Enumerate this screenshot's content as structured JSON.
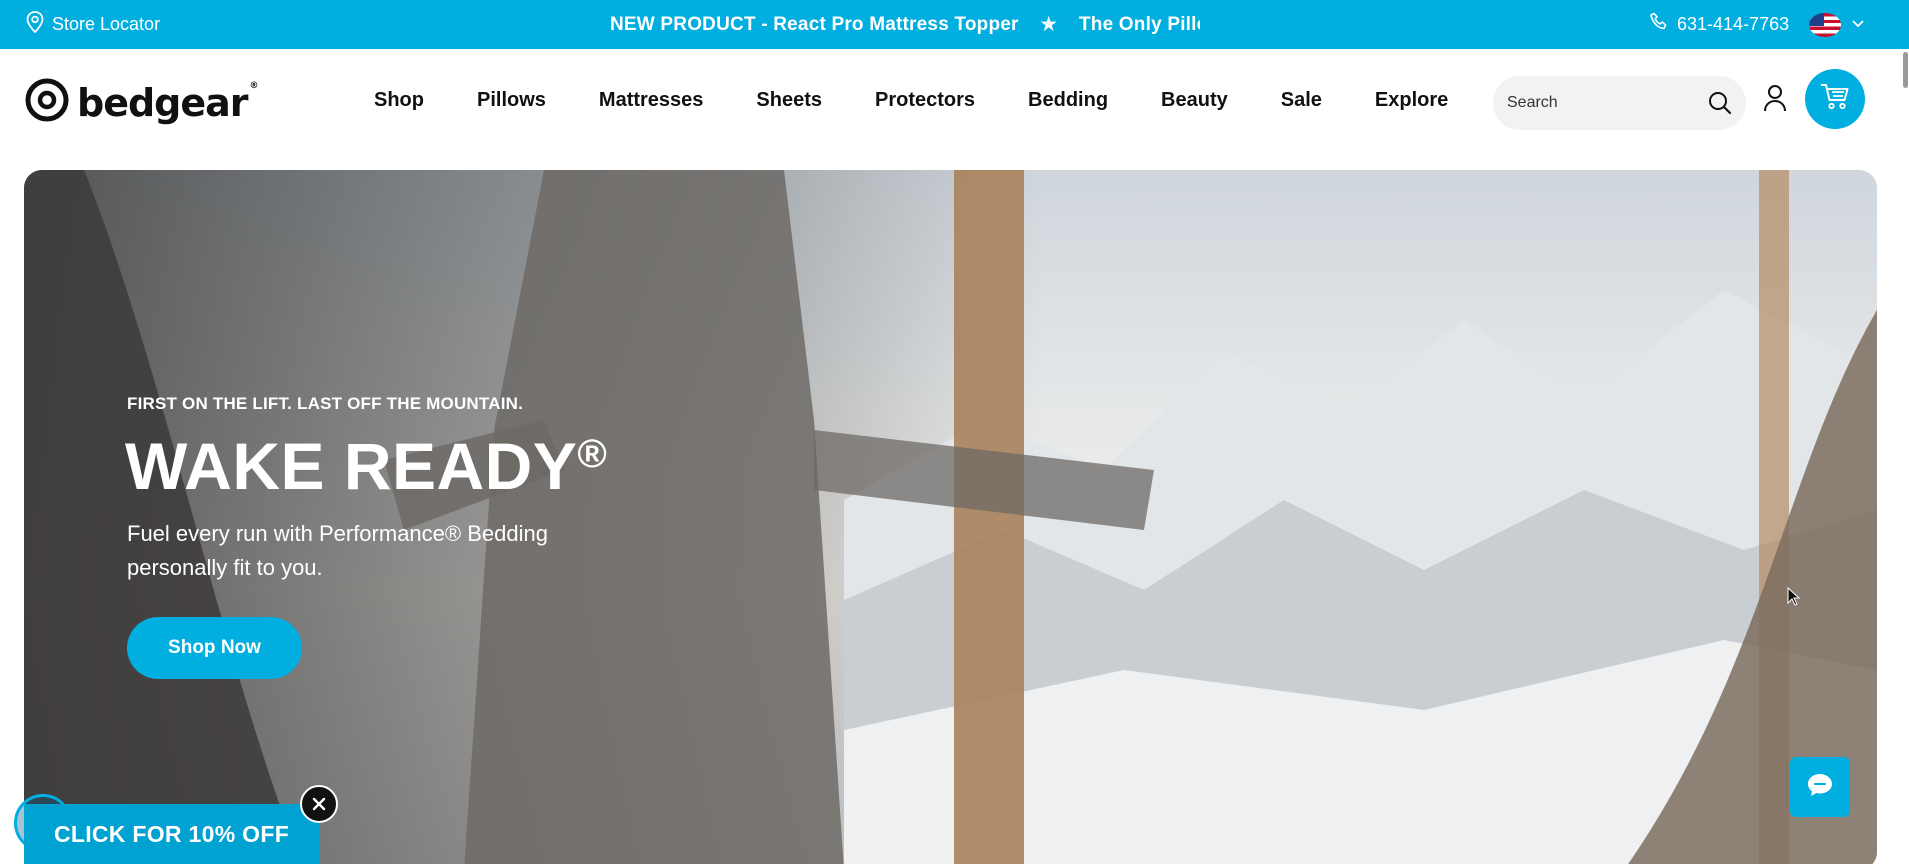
{
  "announcement": {
    "store_locator": "Store Locator",
    "marquee_items": [
      "NEW PRODUCT - React Pro Mattress Topper",
      "The Only Pillow"
    ],
    "phone": "631-414-7763"
  },
  "header": {
    "logo_text": "bedgear",
    "logo_mark": "®",
    "nav": [
      "Shop",
      "Pillows",
      "Mattresses",
      "Sheets",
      "Protectors",
      "Bedding",
      "Beauty",
      "Sale",
      "Explore"
    ],
    "search_placeholder": "Search"
  },
  "hero": {
    "kicker": "FIRST ON THE LIFT. LAST OFF THE MOUNTAIN.",
    "headline": "WAKE READY",
    "headline_mark": "®",
    "subtext": "Fuel every run with Performance® Bedding personally fit to you.",
    "cta": "Shop Now"
  },
  "promo": {
    "label": "CLICK FOR 10% OFF"
  },
  "colors": {
    "brand": "#00aee0",
    "promo": "#00a2d1"
  },
  "icons": [
    "location-pin-icon",
    "star-icon",
    "phone-icon",
    "us-flag-icon",
    "chevron-down-icon",
    "search-icon",
    "user-icon",
    "cart-icon",
    "close-icon",
    "chat-icon"
  ]
}
